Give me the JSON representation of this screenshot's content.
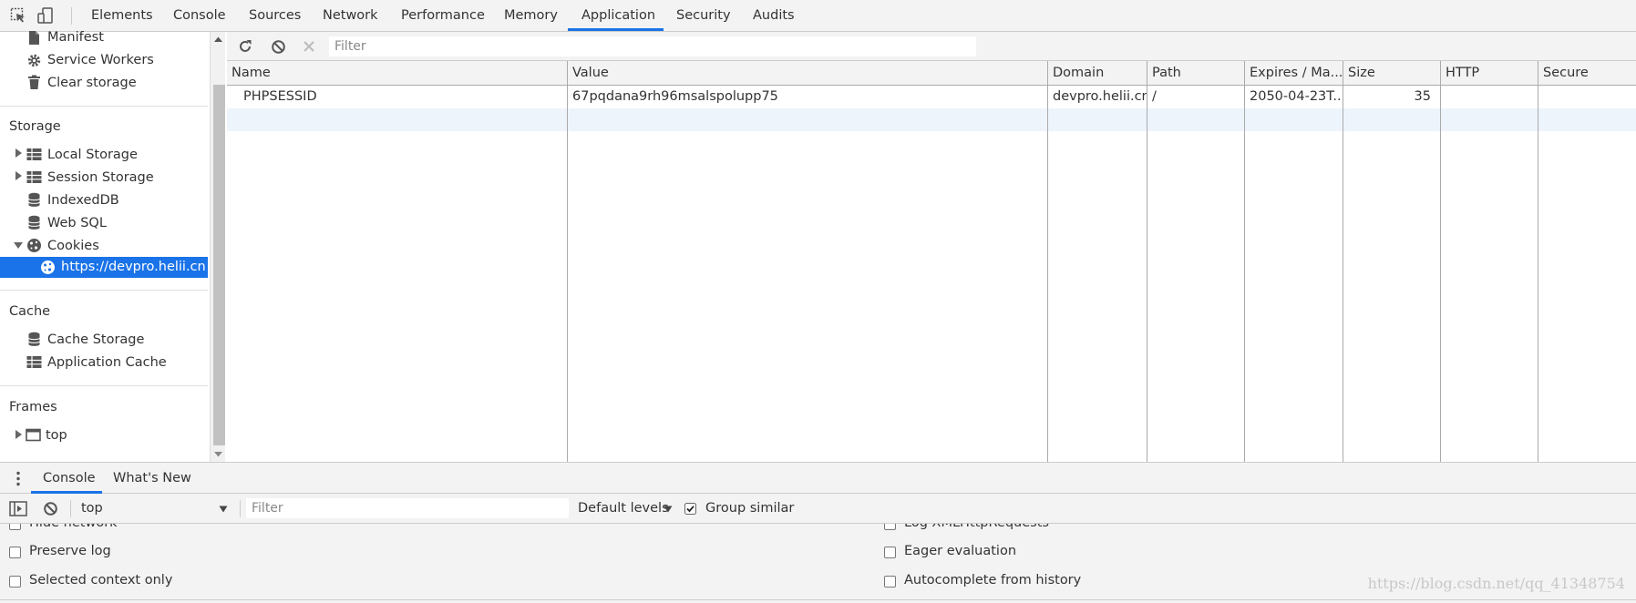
{
  "devtools": {
    "tabs": [
      "Elements",
      "Console",
      "Sources",
      "Network",
      "Performance",
      "Memory",
      "Application",
      "Security",
      "Audits"
    ],
    "active_tab": "Application"
  },
  "sidebar": {
    "application_items": [
      "Manifest",
      "Service Workers",
      "Clear storage"
    ],
    "storage_header": "Storage",
    "storage_items": [
      "Local Storage",
      "Session Storage",
      "IndexedDB",
      "Web SQL",
      "Cookies"
    ],
    "cookie_origin": "https://devpro.helii.cn",
    "cache_header": "Cache",
    "cache_items": [
      "Cache Storage",
      "Application Cache"
    ],
    "frames_header": "Frames",
    "frames_items": [
      "top"
    ]
  },
  "cookies": {
    "filter_placeholder": "Filter",
    "columns": [
      "Name",
      "Value",
      "Domain",
      "Path",
      "Expires / Ma...",
      "Size",
      "HTTP",
      "Secure"
    ],
    "rows": [
      [
        "PHPSESSID",
        "67pqdana9rh96msalspolupp75",
        "devpro.helii.cn",
        "/",
        "2050-04-23T...",
        "35",
        "",
        ""
      ]
    ]
  },
  "drawer": {
    "tabs": [
      "Console",
      "What's New"
    ],
    "active_tab": "Console",
    "context": "top",
    "filter_placeholder": "Filter",
    "levels": "Default levels",
    "group_similar": "Group similar",
    "group_similar_checked": true,
    "settings_left": [
      "Hide network",
      "Preserve log",
      "Selected context only"
    ],
    "settings_right": [
      "Log XMLHttpRequests",
      "Eager evaluation",
      "Autocomplete from history"
    ]
  },
  "watermark": "https://blog.csdn.net/qq_41348754",
  "colors": {
    "accent": "#1a73e8",
    "toolbar": "#f3f3f3",
    "stripe": "#eef4fc"
  }
}
